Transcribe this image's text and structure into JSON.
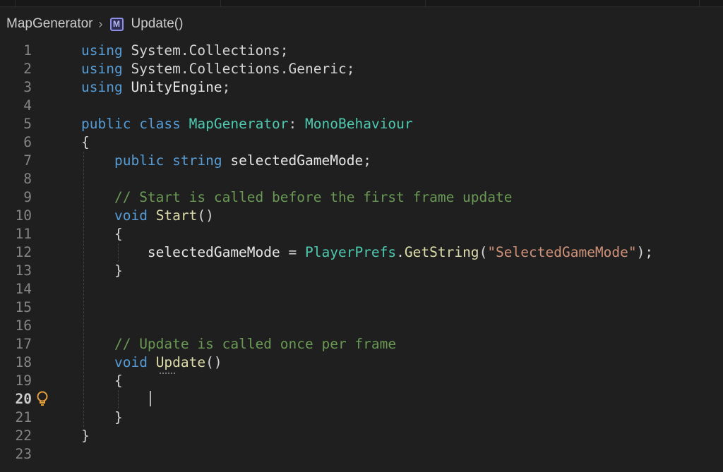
{
  "breadcrumb": {
    "file": "MapGenerator",
    "separator": "›",
    "symbol_icon": "M",
    "symbol": "Update()"
  },
  "colors": {
    "background": "#1f1f1f",
    "keyword": "#569cd6",
    "type": "#4ec9b0",
    "function": "#dcdcaa",
    "string": "#ce9178",
    "comment": "#6a9955",
    "lightbulb": "#e5a03c"
  },
  "editor": {
    "active_line": "20",
    "lines": [
      {
        "n": "1",
        "tokens": [
          {
            "t": "using",
            "c": "kw"
          },
          {
            "t": " "
          },
          {
            "t": "System.Collections",
            "c": "ns"
          },
          {
            "t": ";",
            "c": "punc"
          }
        ]
      },
      {
        "n": "2",
        "tokens": [
          {
            "t": "using",
            "c": "kw"
          },
          {
            "t": " "
          },
          {
            "t": "System.Collections.Generic",
            "c": "ns"
          },
          {
            "t": ";",
            "c": "punc"
          }
        ]
      },
      {
        "n": "3",
        "tokens": [
          {
            "t": "using",
            "c": "kw"
          },
          {
            "t": " "
          },
          {
            "t": "UnityEngine",
            "c": "ident"
          },
          {
            "t": ";",
            "c": "punc"
          }
        ]
      },
      {
        "n": "4",
        "tokens": []
      },
      {
        "n": "5",
        "tokens": [
          {
            "t": "public",
            "c": "kw"
          },
          {
            "t": " "
          },
          {
            "t": "class",
            "c": "kw"
          },
          {
            "t": " "
          },
          {
            "t": "MapGenerator",
            "c": "type"
          },
          {
            "t": ": ",
            "c": "punc"
          },
          {
            "t": "MonoBehaviour",
            "c": "type"
          }
        ]
      },
      {
        "n": "6",
        "tokens": [
          {
            "t": "{",
            "c": "punc"
          }
        ]
      },
      {
        "n": "7",
        "tokens": [
          {
            "t": "    "
          },
          {
            "t": "public",
            "c": "kw"
          },
          {
            "t": " "
          },
          {
            "t": "string",
            "c": "kw"
          },
          {
            "t": " "
          },
          {
            "t": "selectedGameMode",
            "c": "ident"
          },
          {
            "t": ";",
            "c": "punc"
          }
        ]
      },
      {
        "n": "8",
        "tokens": []
      },
      {
        "n": "9",
        "tokens": [
          {
            "t": "    "
          },
          {
            "t": "// Start is called before the first frame update",
            "c": "cmt"
          }
        ]
      },
      {
        "n": "10",
        "tokens": [
          {
            "t": "    "
          },
          {
            "t": "void",
            "c": "kw"
          },
          {
            "t": " "
          },
          {
            "t": "Start",
            "c": "fn"
          },
          {
            "t": "()",
            "c": "punc"
          }
        ]
      },
      {
        "n": "11",
        "tokens": [
          {
            "t": "    "
          },
          {
            "t": "{",
            "c": "punc"
          }
        ]
      },
      {
        "n": "12",
        "tokens": [
          {
            "t": "        "
          },
          {
            "t": "selectedGameMode",
            "c": "ident"
          },
          {
            "t": " = ",
            "c": "punc"
          },
          {
            "t": "PlayerPrefs",
            "c": "type"
          },
          {
            "t": ".",
            "c": "punc"
          },
          {
            "t": "GetString",
            "c": "fn"
          },
          {
            "t": "(",
            "c": "punc"
          },
          {
            "t": "\"SelectedGameMode\"",
            "c": "str"
          },
          {
            "t": ");",
            "c": "punc"
          }
        ]
      },
      {
        "n": "13",
        "tokens": [
          {
            "t": "    "
          },
          {
            "t": "}",
            "c": "punc"
          }
        ]
      },
      {
        "n": "14",
        "tokens": []
      },
      {
        "n": "15",
        "tokens": []
      },
      {
        "n": "16",
        "tokens": []
      },
      {
        "n": "17",
        "tokens": [
          {
            "t": "    "
          },
          {
            "t": "// Update is called once per frame",
            "c": "cmt"
          }
        ]
      },
      {
        "n": "18",
        "tokens": [
          {
            "t": "    "
          },
          {
            "t": "void",
            "c": "kw"
          },
          {
            "t": " "
          },
          {
            "t": "Update",
            "c": "fn"
          },
          {
            "t": "()",
            "c": "punc"
          }
        ]
      },
      {
        "n": "19",
        "tokens": [
          {
            "t": "    "
          },
          {
            "t": "{",
            "c": "punc"
          }
        ]
      },
      {
        "n": "20",
        "tokens": []
      },
      {
        "n": "21",
        "tokens": [
          {
            "t": "    "
          },
          {
            "t": "}",
            "c": "punc"
          }
        ]
      },
      {
        "n": "22",
        "tokens": [
          {
            "t": "}",
            "c": "punc"
          }
        ]
      },
      {
        "n": "23",
        "tokens": []
      }
    ]
  },
  "icons": {
    "lightbulb": "lightbulb-icon",
    "method": "method-symbol-icon"
  }
}
